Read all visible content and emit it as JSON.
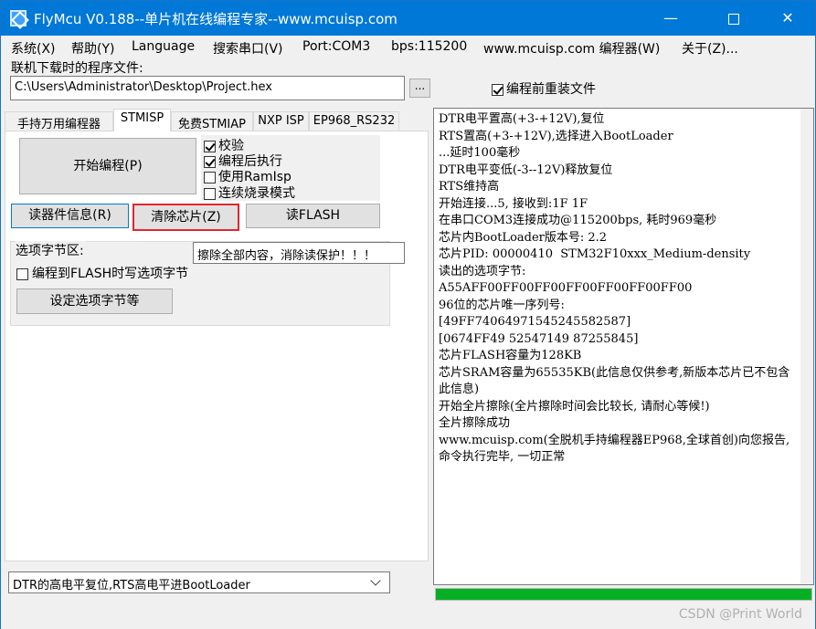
{
  "window": {
    "title": "FlyMcu V0.188--单片机在线编程专家--www.mcuisp.com",
    "minimize": "—",
    "close": "✕"
  },
  "menu": [
    "系统(X)",
    "帮助(Y)",
    "Language",
    "搜索串口(V)",
    "Port:COM3",
    "bps:115200",
    "www.mcuisp.com 编程器(W)",
    "关于(Z)..."
  ],
  "file": {
    "label": "联机下载时的程序文件:",
    "path": "C:\\Users\\Administrator\\Desktop\\Project.hex",
    "browse": "...",
    "reload_label": "编程前重装文件",
    "reload_checked": true
  },
  "tabs": [
    "手持万用编程器",
    "STMISP",
    "免费STMIAP",
    "NXP ISP",
    "EP968_RS232"
  ],
  "active_tab": "STMISP",
  "program": {
    "start_button": "开始编程(P)",
    "options": [
      {
        "label": "校验",
        "checked": true
      },
      {
        "label": "编程后执行",
        "checked": true
      },
      {
        "label": "使用RamIsp",
        "checked": false
      },
      {
        "label": "连续烧录模式",
        "checked": false
      }
    ],
    "read_info_button": "读器件信息(R)",
    "erase_button": "清除芯片(Z)",
    "read_flash_button": "读FLASH",
    "tooltip": "擦除全部内容，消除读保护！！！"
  },
  "option_bytes": {
    "title": "选项字节区:",
    "write_label": "编程到FLASH时写选项字节",
    "write_checked": false,
    "set_button": "设定选项字节等"
  },
  "dtr_mode": "DTR的高电平复位,RTS高电平进BootLoader",
  "log_lines": [
    "DTR电平置高(+3-+12V),复位",
    "RTS置高(+3-+12V),选择进入BootLoader",
    "...延时100毫秒",
    "DTR电平变低(-3--12V)释放复位",
    "RTS维持高",
    "开始连接...5, 接收到:1F 1F",
    "在串口COM3连接成功@115200bps, 耗时969毫秒",
    "芯片内BootLoader版本号: 2.2",
    "芯片PID: 00000410  STM32F10xxx_Medium-density",
    "读出的选项字节:",
    "A55AFF00FF00FF00FF00FF00FF00FF00",
    "96位的芯片唯一序列号:",
    "[49FF74064971545245582587]",
    "[0674FF49 52547149 87255845]",
    "芯片FLASH容量为128KB",
    "芯片SRAM容量为65535KB(此信息仅供参考,新版本芯片已不包含此信息)",
    "开始全片擦除(全片擦除时间会比较长, 请耐心等候!)",
    "全片擦除成功",
    "www.mcuisp.com(全脱机手持编程器EP968,全球首创)向您报告, 命令执行完毕, 一切正常"
  ],
  "progress": 1.0,
  "colors": {
    "titlebar": "#0078d7",
    "progress": "#06b025",
    "highlight": "#e0262e"
  },
  "watermark": "CSDN @Print World"
}
